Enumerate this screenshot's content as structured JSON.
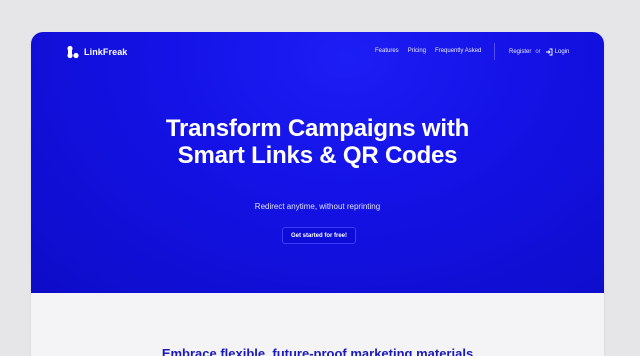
{
  "brand": {
    "name": "LinkFreak",
    "icon": "linkfreak-logo-icon"
  },
  "nav": {
    "links": [
      {
        "label": "Features"
      },
      {
        "label": "Pricing"
      },
      {
        "label": "Frequently Asked"
      }
    ],
    "register_label": "Register",
    "or_label": "or",
    "login_label": "Login",
    "login_icon": "login-icon"
  },
  "hero": {
    "headline_line1": "Transform Campaigns with",
    "headline_line2": "Smart Links & QR Codes",
    "subhead": "Redirect anytime, without reprinting",
    "cta_label": "Get started for free!"
  },
  "section": {
    "title": "Embrace flexible, future-proof marketing materials"
  },
  "colors": {
    "hero_blue": "#1412e6",
    "section_bg": "#f4f4f6",
    "section_title": "#1a1ab8"
  }
}
